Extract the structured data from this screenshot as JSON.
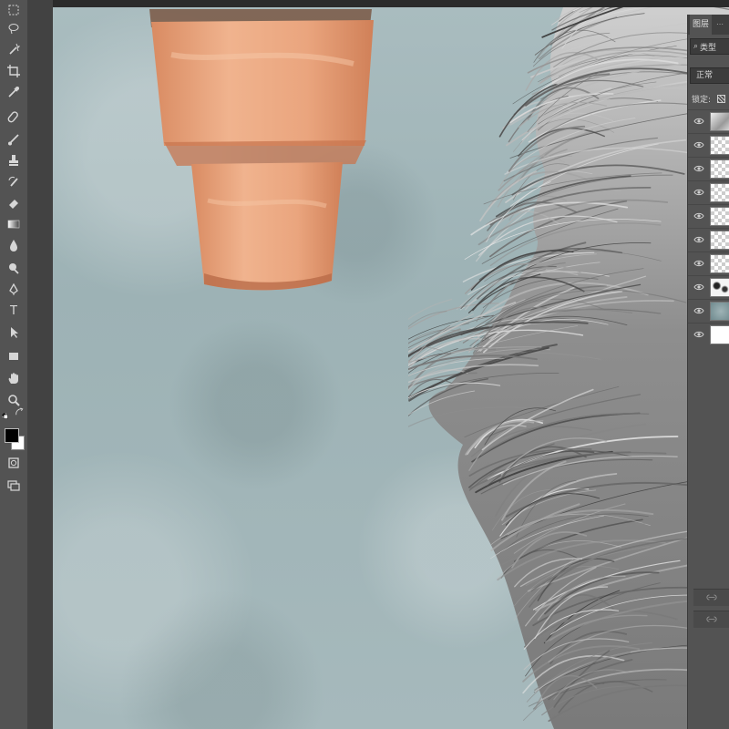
{
  "toolbar": {
    "tools": [
      {
        "name": "marquee-tool-icon"
      },
      {
        "name": "lasso-tool-icon"
      },
      {
        "name": "magic-wand-tool-icon"
      },
      {
        "name": "crop-tool-icon"
      },
      {
        "name": "eyedropper-tool-icon"
      },
      {
        "name": "healing-brush-tool-icon"
      },
      {
        "name": "brush-tool-icon"
      },
      {
        "name": "clone-stamp-tool-icon"
      },
      {
        "name": "history-brush-tool-icon"
      },
      {
        "name": "eraser-tool-icon"
      },
      {
        "name": "gradient-tool-icon"
      },
      {
        "name": "blur-tool-icon"
      },
      {
        "name": "dodge-tool-icon"
      },
      {
        "name": "pen-tool-icon"
      },
      {
        "name": "type-tool-icon",
        "glyph": "T"
      },
      {
        "name": "path-selection-tool-icon"
      },
      {
        "name": "rectangle-tool-icon"
      },
      {
        "name": "hand-tool-icon"
      },
      {
        "name": "zoom-tool-icon"
      }
    ],
    "foreground_color": "#000000",
    "background_color": "#ffffff"
  },
  "canvas": {
    "background_color": "#a3b7ba",
    "pot_color": "#e9a984",
    "fur_color": "#9a9a9a"
  },
  "layers_panel": {
    "tab_label": "图层",
    "filter_label": "类型",
    "blend_mode": "正常",
    "lock_label": "锁定:",
    "layers": [
      {
        "thumb": "fur-sketch"
      },
      {
        "thumb": "transparent"
      },
      {
        "thumb": "transparent"
      },
      {
        "thumb": "transparent"
      },
      {
        "thumb": "transparent"
      },
      {
        "thumb": "transparent"
      },
      {
        "thumb": "transparent"
      },
      {
        "thumb": "brush-marks"
      },
      {
        "thumb": "texture"
      },
      {
        "thumb": "white"
      }
    ]
  }
}
